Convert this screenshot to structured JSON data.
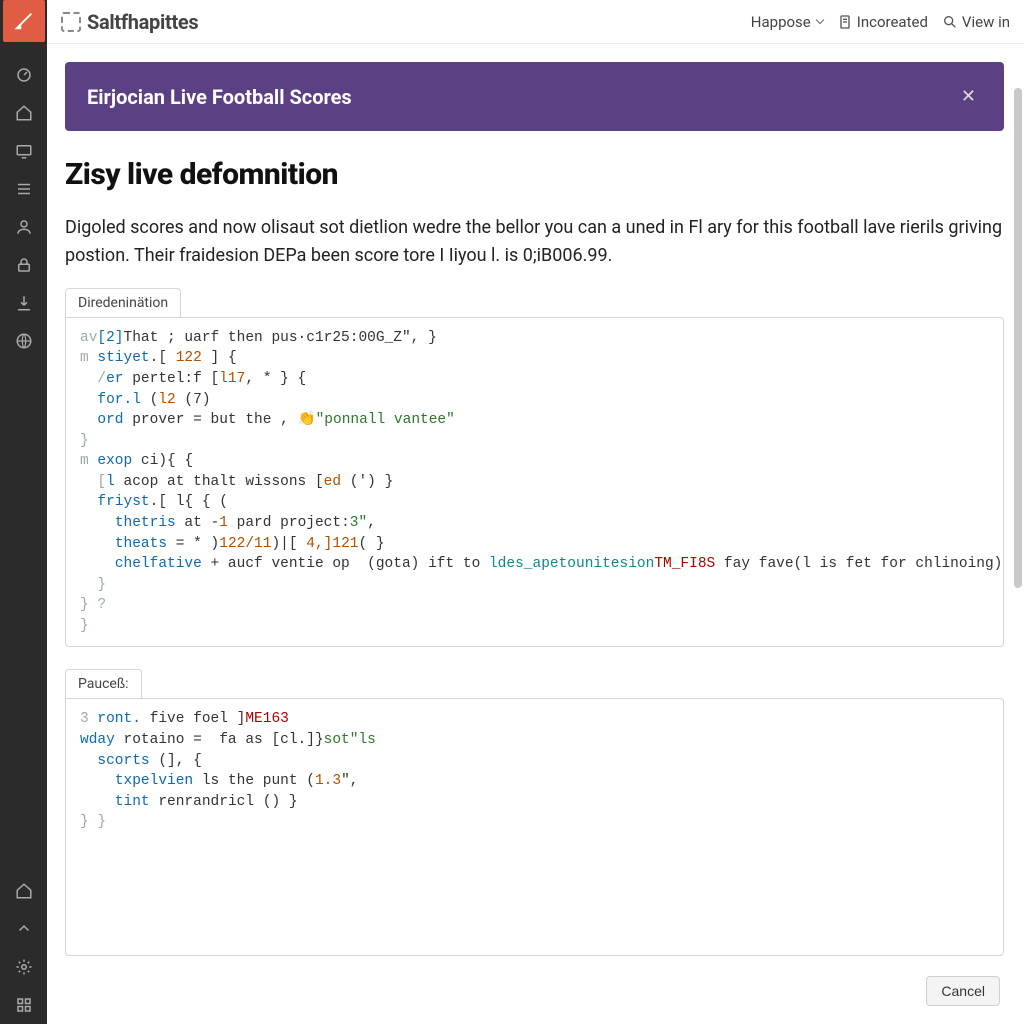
{
  "brand": {
    "name": "Saltfhapittes"
  },
  "topbar": {
    "happose": "Happose",
    "incoreated": "Incoreated",
    "view_in": "View in"
  },
  "rail": {
    "icons": [
      "dashboard-icon",
      "home-icon",
      "screen-icon",
      "list-icon",
      "user-icon",
      "lock-icon",
      "download-icon",
      "globe-icon"
    ],
    "bottom": [
      "home2-icon",
      "collapse-icon",
      "gear-icon",
      "grid-icon"
    ]
  },
  "banner": {
    "title": "Eirjocian Live Football Scores",
    "close": "✕"
  },
  "page": {
    "title": "Zisy live defomnition",
    "description": "Digoled scores and now olisaut sot dietlion wedre the bellor you can a uned in Fl ary for this football lave rierils griving postion. Their fraidesion DEPa been score tore I Iiyou l. is 0;iB006.99."
  },
  "code1": {
    "tab": "Diredeninätion",
    "lines": [
      {
        "pre": "av",
        "a": "[2]",
        "b": "That ; uarf then pus·",
        "c": "c1r25:00G_Z",
        "d": "\", }"
      },
      {
        "pre": "m ",
        "a": "stiyet",
        "b": ".[ ",
        "n": "122",
        "c": " ] {"
      },
      {
        "pre": "  /",
        "a": "er",
        "b": " pertel:f [",
        "n": "l17",
        "c": ", * } {"
      },
      {
        "pre": "  ",
        "a": "for.l",
        "b": " (",
        "n": "l2",
        "c": " (7)"
      },
      {
        "pre": "  ",
        "a": "ord",
        "b": " prover = but the ",
        "s": "\"ponnall vantee\"",
        "c": ", 👏"
      },
      {
        "pre": "}",
        "a": "",
        "b": "",
        "c": ""
      },
      {
        "pre": "m ",
        "a": "exop",
        "b": " ci){ {"
      },
      {
        "pre": "  [",
        "a": "l",
        "b": " acop at thalt wissons [",
        "n": "ed",
        "c": " (') }"
      },
      {
        "pre": "  ",
        "a": "friyst",
        "b": ".[ l{ { ("
      },
      {
        "pre": "    ",
        "a": "thetris",
        "b": " at -",
        "n": "1",
        "c": " pard project:",
        "s": "3\"",
        "d": ","
      },
      {
        "pre": "    ",
        "a": "theats",
        "b": " = * )",
        "n": "122/11",
        "c": ")|[ ",
        "n2": "4,]121",
        "d": "( }"
      },
      {
        "pre": "    ",
        "a": "chelfative",
        "b": " + aucf ventie op ",
        "fn": "ldes_apetounitesion",
        "c": " (gota) ift to ",
        "id": "TM_FI8S",
        "d": " fay fave(l is fet for chlinoing)"
      },
      {
        "pre": "  }",
        "a": "",
        "b": ""
      },
      {
        "pre": "} ?",
        "a": "",
        "b": ""
      },
      {
        "pre": "}",
        "a": "",
        "b": ""
      }
    ]
  },
  "code2": {
    "tab": "Pauceß:",
    "lines": [
      {
        "pre": "3 ",
        "a": "ront.",
        "id": "ME163",
        "b": " five foel ]"
      },
      {
        "pre": "",
        "a": "wday",
        "b": " rotaino = ",
        "s": "sot\"ls",
        "c": " fa as [cl.]}"
      },
      {
        "pre": "  ",
        "a": "scorts",
        "b": " (], {"
      },
      {
        "pre": "    ",
        "a": "txpelvien",
        "b": " ls the punt (",
        "n": "1.3",
        "c": "\","
      },
      {
        "pre": "    ",
        "a": "tint",
        "b": " renrandricl () }"
      },
      {
        "pre": "} }",
        "a": "",
        "b": ""
      }
    ]
  },
  "footer": {
    "cancel": "Cancel"
  }
}
